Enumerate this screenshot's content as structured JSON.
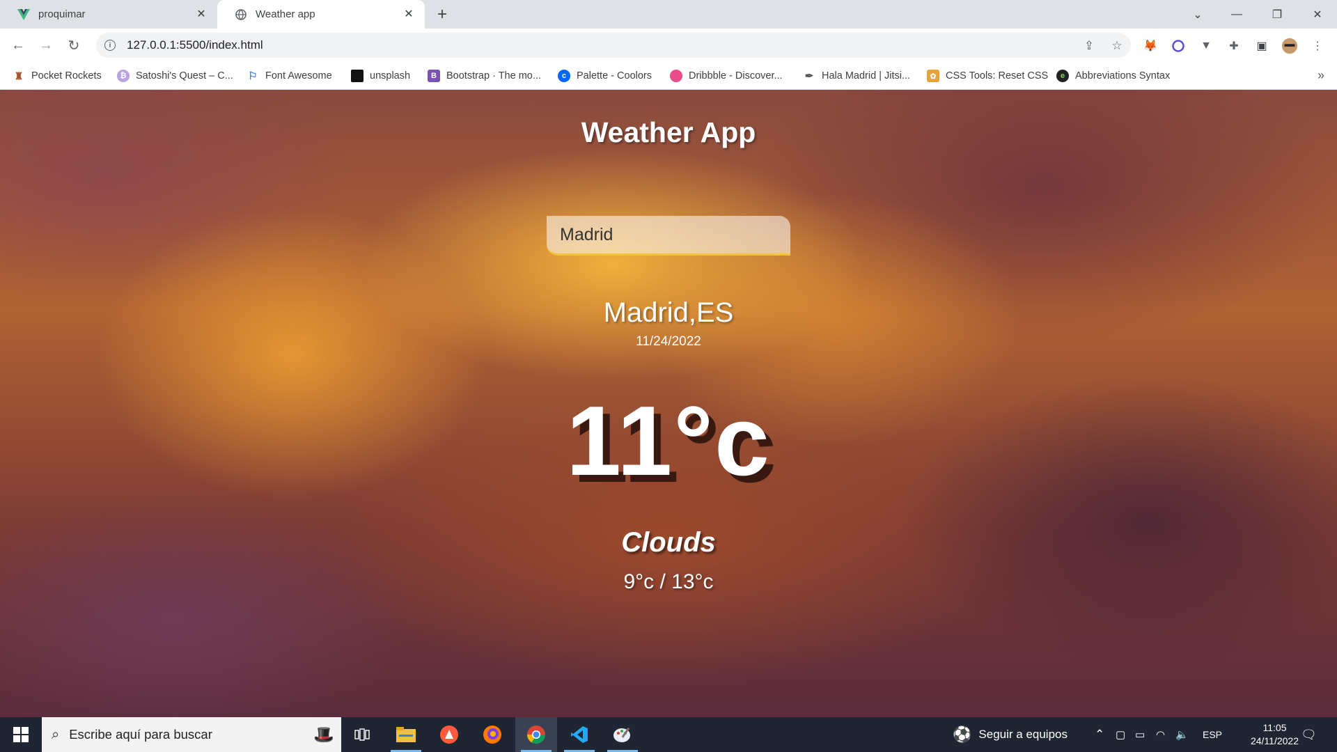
{
  "browser": {
    "tabs": [
      {
        "title": "proquimar",
        "favicon": "vue-logo-icon"
      },
      {
        "title": "Weather app",
        "favicon": "globe-icon"
      }
    ],
    "url": "127.0.0.1:5500/index.html",
    "bookmarks": [
      {
        "label": "Pocket Rockets",
        "icon": "rocket-icon"
      },
      {
        "label": "Satoshi's Quest – C...",
        "icon": "satoshi-icon"
      },
      {
        "label": "Font Awesome",
        "icon": "flag-icon"
      },
      {
        "label": "unsplash",
        "icon": "unsplash-icon"
      },
      {
        "label": "Bootstrap · The mo...",
        "icon": "bootstrap-icon"
      },
      {
        "label": "Palette - Coolors",
        "icon": "coolors-icon"
      },
      {
        "label": "Dribbble - Discover...",
        "icon": "dribbble-icon"
      },
      {
        "label": "Hala Madrid | Jitsi...",
        "icon": "feather-icon"
      },
      {
        "label": "CSS Tools: Reset CSS",
        "icon": "css-tools-icon"
      },
      {
        "label": "Abbreviations Syntax",
        "icon": "emmet-icon"
      }
    ]
  },
  "app": {
    "title": "Weather App",
    "search_value": "Madrid",
    "city": "Madrid,ES",
    "date": "11/24/2022",
    "temperature": "11°c",
    "condition": "Clouds",
    "range": "9°c / 13°c"
  },
  "taskbar": {
    "search_placeholder": "Escribe aquí para buscar",
    "teams_label": "Seguir a equipos",
    "lang": "ESP",
    "time": "11:05",
    "date": "24/11/2022"
  },
  "colors": {
    "accent_underline": "#f5c23a",
    "taskbar": "#202533",
    "tabstrip": "#dee1e6"
  }
}
